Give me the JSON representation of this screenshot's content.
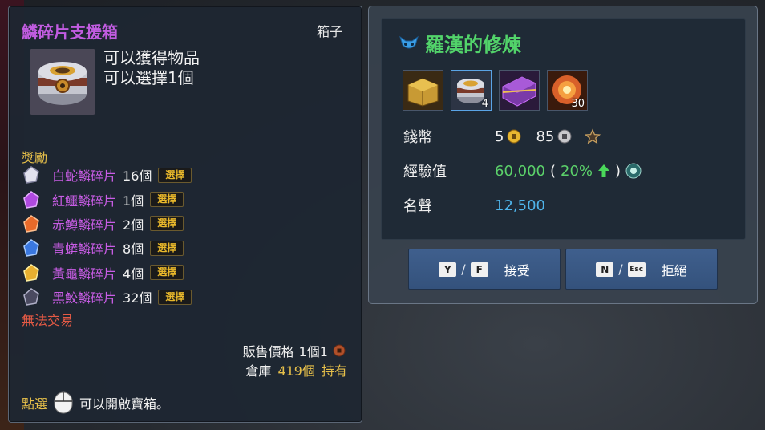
{
  "tooltip": {
    "title": "鱗碎片支援箱",
    "type": "箱子",
    "desc_line1": "可以獲得物品",
    "desc_line2": "可以選擇1個",
    "rewards_label": "獎勵",
    "rewards": [
      {
        "name": "白蛇鱗碎片",
        "count": "16個",
        "select": "選擇",
        "color": "#d8d8e8"
      },
      {
        "name": "紅鱷鱗碎片",
        "count": "1個",
        "select": "選擇",
        "color": "#b04ae0"
      },
      {
        "name": "赤鱒鱗碎片",
        "count": "2個",
        "select": "選擇",
        "color": "#e86a2a"
      },
      {
        "name": "青蟒鱗碎片",
        "count": "8個",
        "select": "選擇",
        "color": "#3a78e0"
      },
      {
        "name": "黃龜鱗碎片",
        "count": "4個",
        "select": "選擇",
        "color": "#e8b030"
      },
      {
        "name": "黑鮫鱗碎片",
        "count": "32個",
        "select": "選擇",
        "color": "#8a8aa0"
      }
    ],
    "no_trade": "無法交易",
    "sell_label": "販售價格",
    "sell_value": "1個1",
    "store_label": "倉庫",
    "store_count": "419個",
    "store_own": "持有",
    "hint_click": "點選",
    "hint_text": "可以開啟寶箱。"
  },
  "quest": {
    "title": "羅漢的修煉",
    "reward_items": [
      {
        "icon": "golden-chest-icon",
        "count": ""
      },
      {
        "icon": "silver-box-icon",
        "count": "4"
      },
      {
        "icon": "purple-chest-icon",
        "count": ""
      },
      {
        "icon": "fire-orb-icon",
        "count": "30"
      }
    ],
    "money_label": "錢幣",
    "money_gold": "5",
    "money_silver": "85",
    "exp_label": "經驗值",
    "exp_value": "60,000",
    "exp_bonus": "20%",
    "fame_label": "名聲",
    "fame_value": "12,500",
    "accept_key1": "Y",
    "accept_key2": "F",
    "accept_label": "接受",
    "reject_key1": "N",
    "reject_key2": "Esc",
    "reject_label": "拒絕"
  },
  "colors": {
    "title_purple": "#c15ce0",
    "gold_text": "#e7c04a",
    "quest_green": "#52d36a",
    "fame_blue": "#4fb4ea",
    "warn_red": "#e45a45",
    "button_blue": "#3f5f8d"
  }
}
